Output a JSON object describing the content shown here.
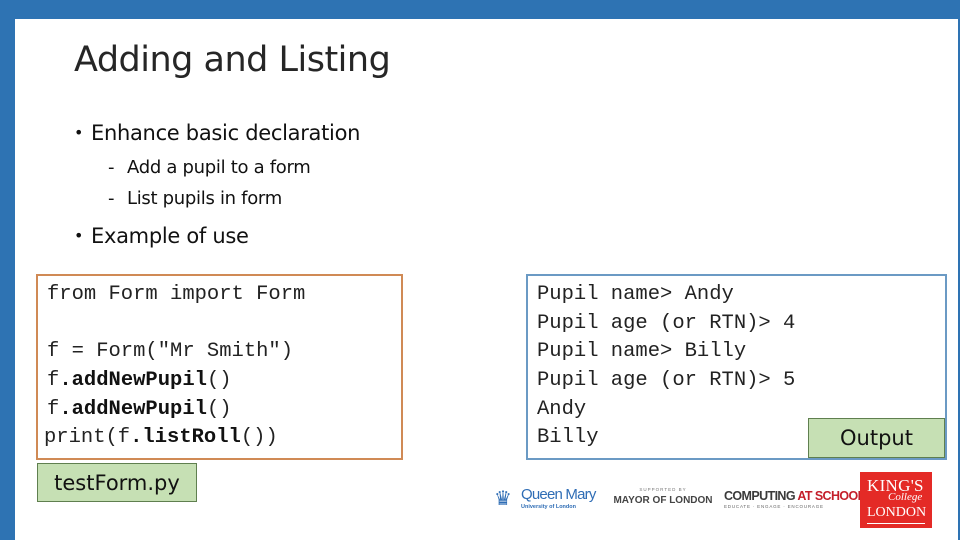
{
  "slide": {
    "title": "Adding and Listing",
    "bullets": [
      {
        "text": "Enhance basic declaration",
        "subitems": [
          "Add a pupil to a form",
          "List pupils in  form"
        ]
      },
      {
        "text": "Example of use",
        "subitems": []
      }
    ],
    "bullet_glyph": "•",
    "dash_glyph": "-"
  },
  "code": {
    "lines": [
      [
        {
          "t": "from Form import Form",
          "b": false
        }
      ],
      [
        {
          "t": "",
          "b": false
        }
      ],
      [
        {
          "t": "f = Form(\"Mr Smith\")",
          "b": false
        }
      ],
      [
        {
          "t": "f",
          "b": false
        },
        {
          "t": ".addNewPupil",
          "b": true
        },
        {
          "t": "()",
          "b": false
        }
      ],
      [
        {
          "t": "f",
          "b": false
        },
        {
          "t": ".addNewPupil",
          "b": true
        },
        {
          "t": "()",
          "b": false
        }
      ],
      [
        {
          "t": "print(f",
          "b": false
        },
        {
          "t": ".listRoll",
          "b": true
        },
        {
          "t": "())",
          "b": false
        }
      ]
    ],
    "filename_label": "testForm.py"
  },
  "output": {
    "lines": [
      "Pupil name> Andy",
      "Pupil age (or RTN)> 4",
      "Pupil name> Billy",
      "Pupil age (or RTN)> 5",
      "Andy",
      "Billy"
    ],
    "label": "Output"
  },
  "logos": {
    "queen_mary": {
      "icon": "crown-icon",
      "name": "Queen Mary",
      "sub": "University of London"
    },
    "mayor": {
      "supported_by": "SUPPORTED BY",
      "name": "MAYOR OF LONDON"
    },
    "cas": {
      "part1": "COMPUTING ",
      "part2": "AT SCHOOL",
      "tagline": "EDUCATE · ENGAGE · ENCOURAGE"
    },
    "kings": {
      "line1": "KING'S",
      "line2": "College",
      "line3": "LONDON"
    }
  },
  "colors": {
    "frame_blue": "#2e73b3",
    "code_border": "#d08a55",
    "output_border": "#6b9ac4",
    "label_green": "#c6e0b4",
    "kings_red": "#e42a26"
  }
}
